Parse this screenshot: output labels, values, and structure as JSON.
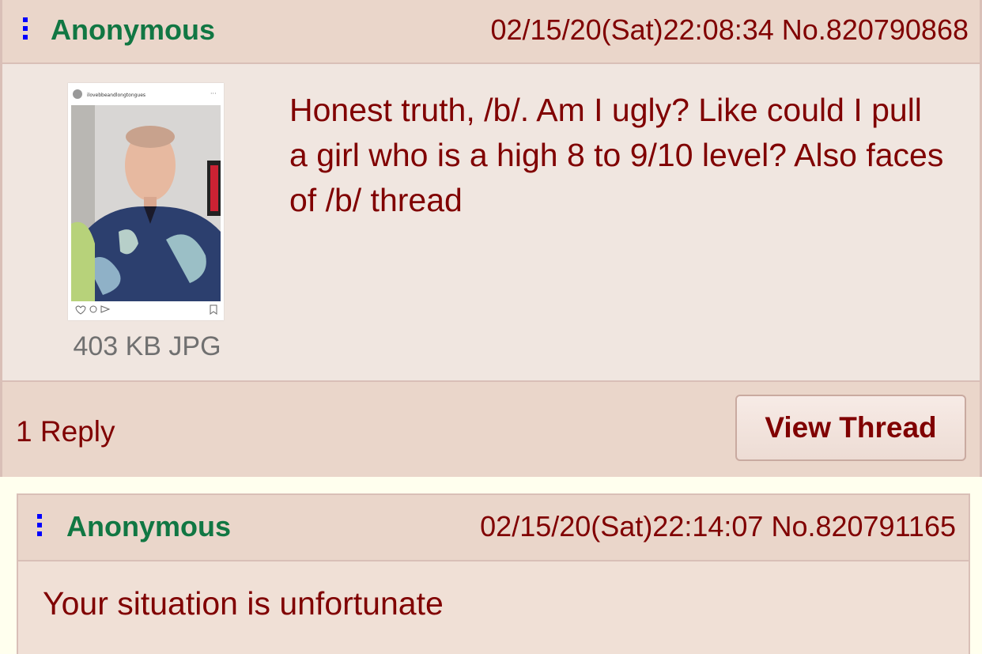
{
  "op": {
    "name": "Anonymous",
    "datetime": "02/15/20(Sat)22:08:34",
    "post_no": "No.820790868",
    "image_caption": "ilovebbeandlongtongues",
    "file_info": "403 KB JPG",
    "comment": "Honest truth, /b/. Am I ugly? Like could I pull a girl who is a high 8 to 9/10 level? Also faces of /b/ thread",
    "reply_count": "1 Reply",
    "view_thread_label": "View Thread"
  },
  "reply": {
    "name": "Anonymous",
    "datetime": "02/15/20(Sat)22:14:07",
    "post_no": "No.820791165",
    "comment": "Your situation is unfortunate"
  },
  "colors": {
    "name_green": "#117743",
    "text_maroon": "#800000",
    "post_bg": "#f0e0d6",
    "page_bg": "#ffffee",
    "menu_blue": "#0000ff"
  }
}
